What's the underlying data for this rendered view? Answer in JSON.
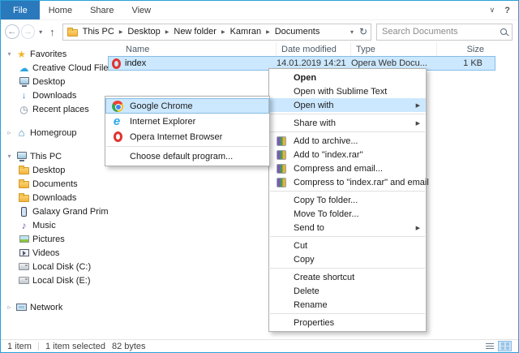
{
  "ribbon": {
    "tabs": [
      {
        "label": "File"
      },
      {
        "label": "Home"
      },
      {
        "label": "Share"
      },
      {
        "label": "View"
      }
    ]
  },
  "address_bar": {
    "breadcrumbs": [
      "This PC",
      "Desktop",
      "New folder",
      "Kamran",
      "Documents"
    ],
    "separator": "▶",
    "search_placeholder": "Search Documents"
  },
  "icons": {
    "back": "←",
    "forward": "→",
    "up": "↑",
    "dropdown": "▾",
    "refresh": "↻",
    "submenu_arrow": "▶",
    "expand_ribbon": "∨",
    "help": "?",
    "star": "★",
    "cloud": "☁",
    "download": "↓",
    "clock": "◷",
    "house": "⌂",
    "music": "♪",
    "tree_expanded": "▾",
    "tree_collapsed": "▹"
  },
  "sidebar": {
    "items": [
      "Favorites",
      "Creative Cloud Files",
      "Desktop",
      "Downloads",
      "Recent places",
      "Homegroup",
      "This PC",
      "Desktop",
      "Documents",
      "Downloads",
      "Galaxy Grand Prime",
      "Music",
      "Pictures",
      "Videos",
      "Local Disk (C:)",
      "Local Disk (E:)",
      "Network"
    ]
  },
  "file_list": {
    "columns": [
      "Name",
      "Date modified",
      "Type",
      "Size"
    ],
    "rows": [
      {
        "name": "index",
        "date_modified": "14.01.2019 14:21",
        "type": "Opera Web Docu...",
        "size": "1 KB"
      }
    ]
  },
  "context_menu": {
    "items": [
      "Open",
      "Open with Sublime Text",
      "Open with",
      "Share with",
      "Add to archive...",
      "Add to \"index.rar\"",
      "Compress and email...",
      "Compress to \"index.rar\" and email",
      "Copy To folder...",
      "Move To folder...",
      "Send to",
      "Cut",
      "Copy",
      "Create shortcut",
      "Delete",
      "Rename",
      "Properties"
    ]
  },
  "open_with_submenu": {
    "items": [
      "Google Chrome",
      "Internet Explorer",
      "Opera Internet Browser",
      "Choose default program..."
    ]
  },
  "status_bar": {
    "items_text": "1 item",
    "selection_text": "1 item selected",
    "size_text": "82 bytes"
  },
  "colors": {
    "window_border": "#29a0d8",
    "file_tab": "#2a79bd",
    "selection": "#cce8ff",
    "selection_border": "#84bde6"
  }
}
